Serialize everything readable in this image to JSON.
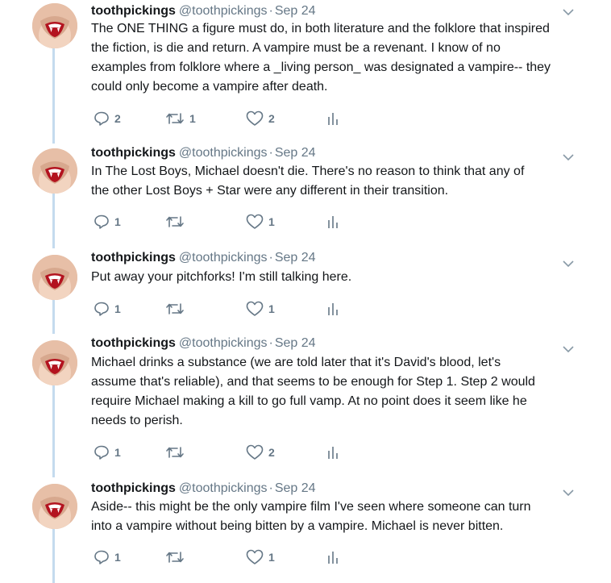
{
  "tweets": [
    {
      "username": "toothpickings",
      "handle": "@toothpickings",
      "separator": "·",
      "date": "Sep 24",
      "lines": [
        "The ONE THING a figure must do, in both literature and the folklore that inspired",
        "the fiction, is die and return.  A vampire must be a revenant.  I know of no",
        "examples from folklore where a _living person_ was designated a vampire-- they",
        "could only become a vampire after death."
      ],
      "replies": "2",
      "retweets": "1",
      "likes": "2"
    },
    {
      "username": "toothpickings",
      "handle": "@toothpickings",
      "separator": "·",
      "date": "Sep 24",
      "lines": [
        "In The Lost Boys, Michael doesn't die.  There's no reason to think that any of",
        "the other Lost Boys + Star were any different in their transition."
      ],
      "replies": "1",
      "retweets": "",
      "likes": "1"
    },
    {
      "username": "toothpickings",
      "handle": "@toothpickings",
      "separator": "·",
      "date": "Sep 24",
      "lines": [
        "Put away your pitchforks!  I'm still talking here."
      ],
      "replies": "1",
      "retweets": "",
      "likes": "1"
    },
    {
      "username": "toothpickings",
      "handle": "@toothpickings",
      "separator": "·",
      "date": "Sep 24",
      "lines": [
        "Michael drinks a substance (we are told later that it's David's blood, let's",
        "assume that's reliable), and that seems to be enough for Step 1.  Step 2 would",
        "require Michael making a kill to go full vamp.  At no point does it seem like he",
        "needs to perish."
      ],
      "replies": "1",
      "retweets": "",
      "likes": "2"
    },
    {
      "username": "toothpickings",
      "handle": "@toothpickings",
      "separator": "·",
      "date": "Sep 24",
      "lines": [
        "Aside-- this might be the only vampire film I've seen where someone can turn",
        "into a vampire without being bitten by a vampire.  Michael is never bitten."
      ],
      "replies": "1",
      "retweets": "",
      "likes": "1"
    }
  ],
  "icons": {
    "reply": "reply-icon",
    "retweet": "retweet-icon",
    "like": "heart-icon",
    "analytics": "analytics-icon",
    "caret": "chevron-down-icon"
  },
  "colors": {
    "thread_line": "#c4dbee",
    "muted": "#657786",
    "text": "#14171a"
  }
}
